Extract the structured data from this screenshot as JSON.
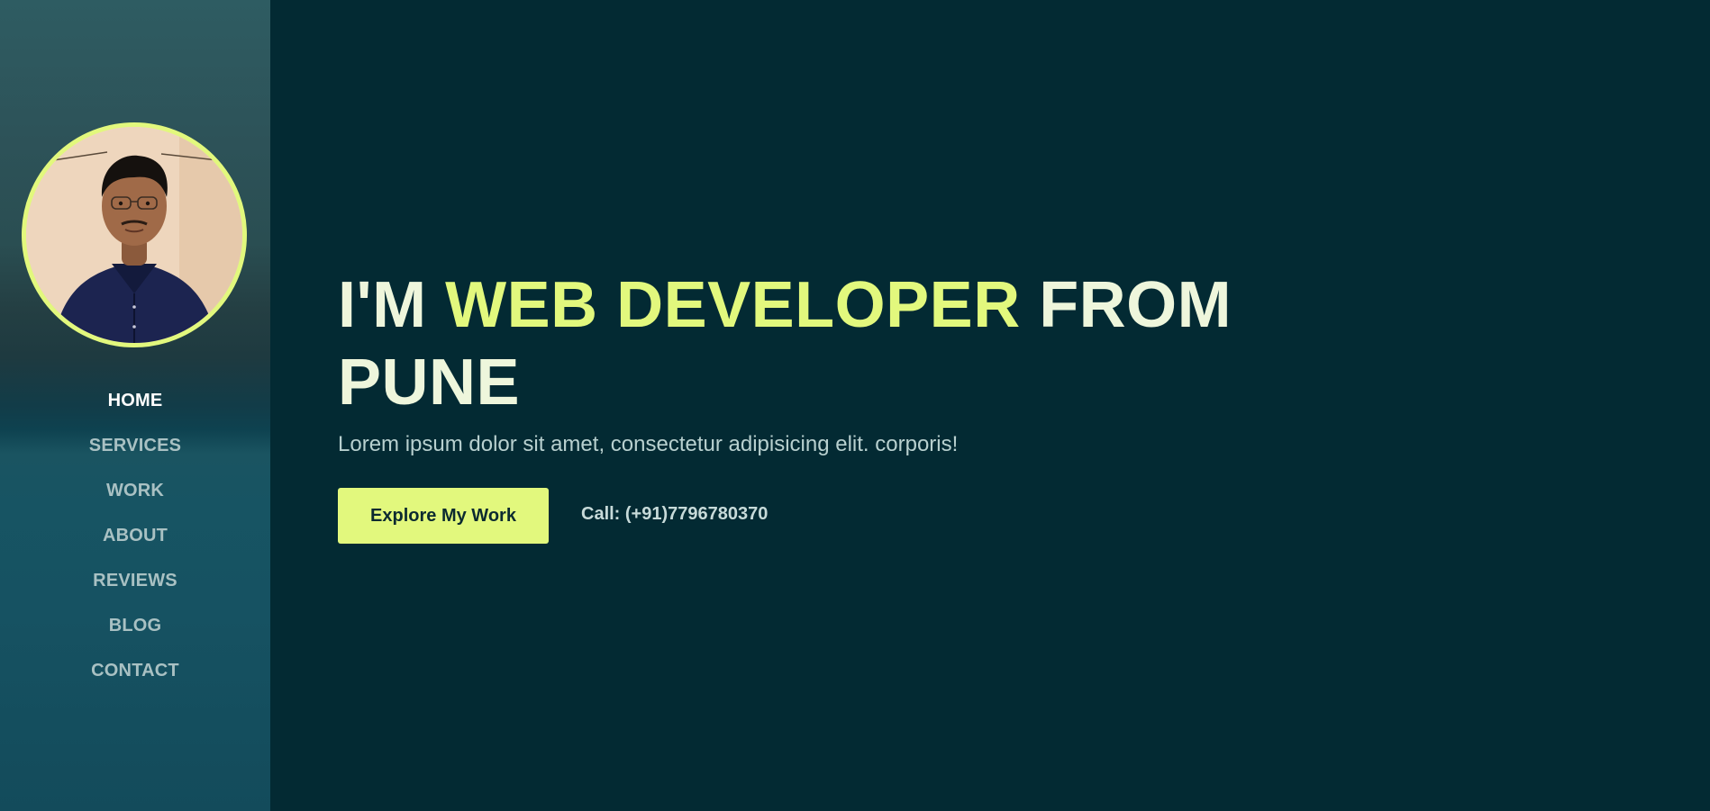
{
  "sidebar": {
    "nav": [
      {
        "label": "HOME",
        "active": true
      },
      {
        "label": "SERVICES"
      },
      {
        "label": "WORK"
      },
      {
        "label": "ABOUT"
      },
      {
        "label": "REVIEWS"
      },
      {
        "label": "BLOG"
      },
      {
        "label": "CONTACT"
      }
    ]
  },
  "hero": {
    "title_prefix": "I'M ",
    "title_accent": "WEB DEVELOPER",
    "title_suffix": " FROM PUNE",
    "subtitle": "Lorem ipsum dolor sit amet, consectetur adipisicing elit. corporis!",
    "cta_label": "Explore My Work",
    "call_text": "Call: (+91)7796780370"
  },
  "colors": {
    "background": "#032a33",
    "accent": "#e2f87d",
    "heading": "#eef6dc",
    "nav_inactive": "#a9c1c3"
  },
  "icons": {
    "avatar": "profile-photo"
  }
}
